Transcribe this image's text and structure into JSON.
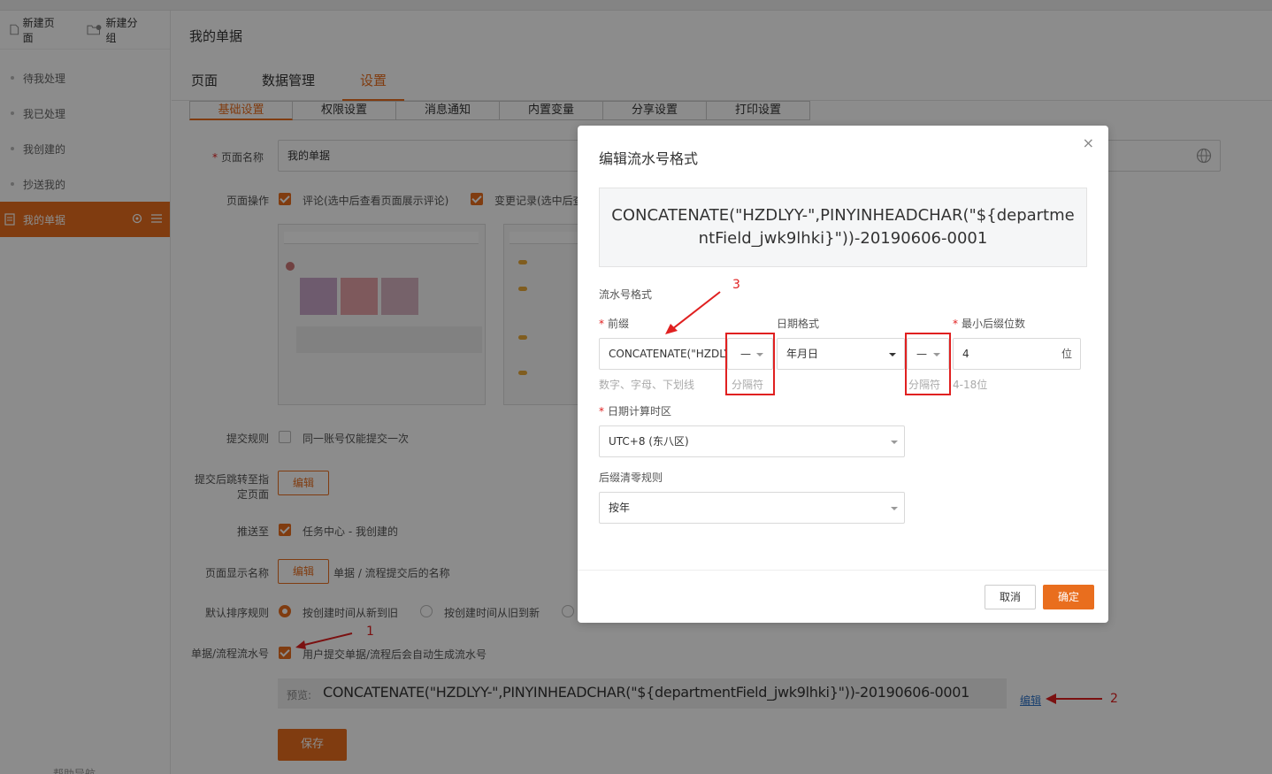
{
  "sidebar": {
    "new_page": "新建页面",
    "new_group": "新建分组",
    "items": [
      "待我处理",
      "我已处理",
      "我创建的",
      "抄送我的",
      "我的单据"
    ],
    "bottom": "帮助导航"
  },
  "header": {
    "title": "我的单据",
    "tabs": [
      "页面",
      "数据管理",
      "设置"
    ],
    "subtabs": [
      "基础设置",
      "权限设置",
      "消息通知",
      "内置变量",
      "分享设置",
      "打印设置"
    ]
  },
  "form": {
    "page_name_label": "页面名称",
    "page_name_value": "我的单据",
    "page_ops_label": "页面操作",
    "op_comment": "评论(选中后查看页面展示评论)",
    "op_changelog": "变更记录(选中后查",
    "submit_rule_label": "提交规则",
    "submit_rule_text": "同一账号仅能提交一次",
    "redirect_label_1": "提交后跳转至指",
    "redirect_label_2": "定页面",
    "edit_btn": "编辑",
    "push_label": "推送至",
    "push_text": "任务中心 - 我创建的",
    "display_name_label": "页面显示名称",
    "display_name_text": "单据 / 流程提交后的名称",
    "sort_label": "默认排序规则",
    "sort_new_old": "按创建时间从新到旧",
    "sort_old_new": "按创建时间从旧到新",
    "serial_label": "单据/流程流水号",
    "serial_text": "用户提交单据/流程后会自动生成流水号",
    "preview_label": "预览:",
    "preview_value": "CONCATENATE(\"HZDLYY-\",PINYINHEADCHAR(\"${departmentField_jwk9lhki}\"))-20190606-0001",
    "edit_link": "编辑",
    "save_btn": "保存"
  },
  "modal": {
    "title": "编辑流水号格式",
    "close": "×",
    "formula": "CONCATENATE(\"HZDLYY-\",PINYINHEADCHAR(\"${departmentField_jwk9lhki}\"))-20190606-0001",
    "section_label": "流水号格式",
    "prefix_label": "前缀",
    "prefix_value": "CONCATENATE(\"HZDLYY-\",PINYINHEADCHAR(",
    "prefix_hint": "数字、字母、下划线",
    "sep_value": "—",
    "sep_hint": "分隔符",
    "date_label": "日期格式",
    "date_value": "年月日",
    "min_digits_label": "最小后缀位数",
    "min_digits_value": "4",
    "min_digits_unit": "位",
    "min_digits_hint": "4-18位",
    "tz_label": "日期计算时区",
    "tz_value": "UTC+8 (东八区)",
    "reset_label": "后缀清零规则",
    "reset_value": "按年",
    "cancel": "取消",
    "ok": "确定"
  },
  "annotations": [
    "1",
    "2",
    "3"
  ],
  "colors": {
    "accent": "#e96e1e",
    "annotation": "#e02020",
    "link": "#2f74c9"
  }
}
